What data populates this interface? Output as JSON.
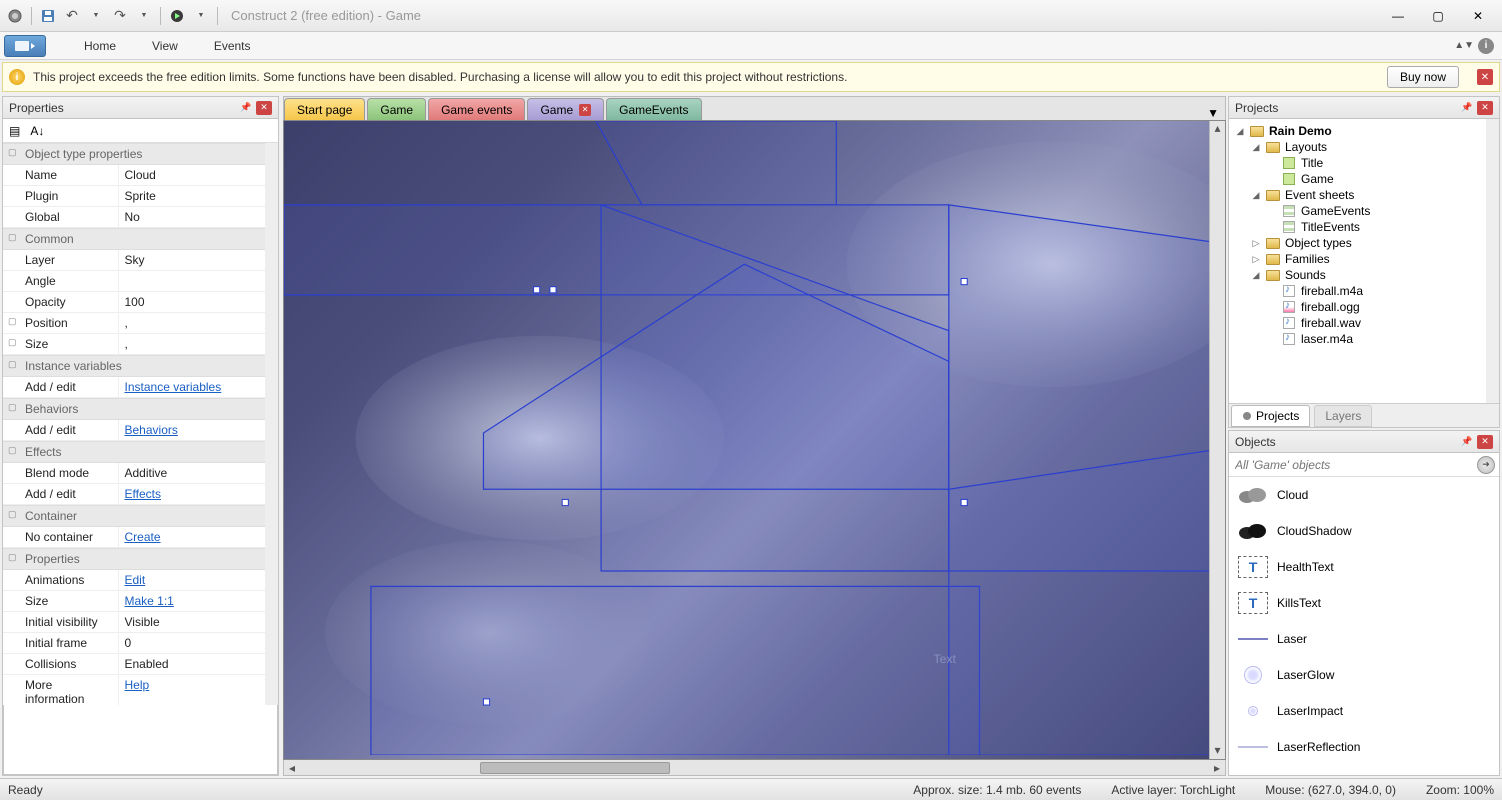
{
  "titlebar": {
    "title": "Construct 2  (free edition) - Game"
  },
  "ribbon": {
    "tabs": {
      "home": "Home",
      "view": "View",
      "events": "Events"
    }
  },
  "notice": {
    "text": "This project exceeds the free edition limits.  Some functions have been disabled.  Purchasing a license will allow you to edit this project without restrictions.",
    "buy": "Buy now"
  },
  "docTabs": {
    "start": "Start page",
    "game": "Game",
    "gameEvents": "Game events",
    "gameActive": "Game",
    "gameEvents2": "GameEvents"
  },
  "properties": {
    "title": "Properties",
    "groups": {
      "objType": "Object type properties",
      "common": "Common",
      "instanceVars": "Instance variables",
      "behaviors": "Behaviors",
      "effects": "Effects",
      "container": "Container",
      "props": "Properties"
    },
    "rows": {
      "name_k": "Name",
      "name_v": "Cloud",
      "plugin_k": "Plugin",
      "plugin_v": "Sprite",
      "global_k": "Global",
      "global_v": "No",
      "layer_k": "Layer",
      "layer_v": "Sky",
      "angle_k": "Angle",
      "angle_v": "",
      "opacity_k": "Opacity",
      "opacity_v": "100",
      "position_k": "Position",
      "position_v": ",",
      "size_k": "Size",
      "size_v": ",",
      "addedit": "Add / edit",
      "instanceVarsLink": "Instance variables",
      "behaviorsLink": "Behaviors",
      "blend_k": "Blend mode",
      "blend_v": "Additive",
      "effectsLink": "Effects",
      "nocontainer": "No container",
      "createLink": "Create",
      "anim_k": "Animations",
      "anim_v": "Edit",
      "psize_k": "Size",
      "psize_v": "Make 1:1",
      "initvis_k": "Initial visibility",
      "initvis_v": "Visible",
      "initframe_k": "Initial frame",
      "initframe_v": "0",
      "collisions_k": "Collisions",
      "collisions_v": "Enabled",
      "moreinfo_k": "More information",
      "moreinfo_v": "Help"
    }
  },
  "projects": {
    "title": "Projects",
    "root": "Rain Demo",
    "layouts": "Layouts",
    "layout_title": "Title",
    "layout_game": "Game",
    "eventSheets": "Event sheets",
    "sheet_game": "GameEvents",
    "sheet_title": "TitleEvents",
    "objectTypes": "Object types",
    "families": "Families",
    "sounds": "Sounds",
    "s1": "fireball.m4a",
    "s2": "fireball.ogg",
    "s3": "fireball.wav",
    "s4": "laser.m4a",
    "tabProjects": "Projects",
    "tabLayers": "Layers"
  },
  "objects": {
    "title": "Objects",
    "filterPlaceholder": "All 'Game' objects",
    "items": {
      "cloud": "Cloud",
      "cloudShadow": "CloudShadow",
      "healthText": "HealthText",
      "killsText": "KillsText",
      "laser": "Laser",
      "laserGlow": "LaserGlow",
      "laserImpact": "LaserImpact",
      "laserReflection": "LaserReflection"
    }
  },
  "status": {
    "ready": "Ready",
    "approx": "Approx. size: 1.4 mb. 60 events",
    "layer": "Active layer: TorchLight",
    "mouse": "Mouse: (627.0, 394.0, 0)",
    "zoom": "Zoom: 100%"
  },
  "viewport": {
    "textLabel": "Text"
  }
}
